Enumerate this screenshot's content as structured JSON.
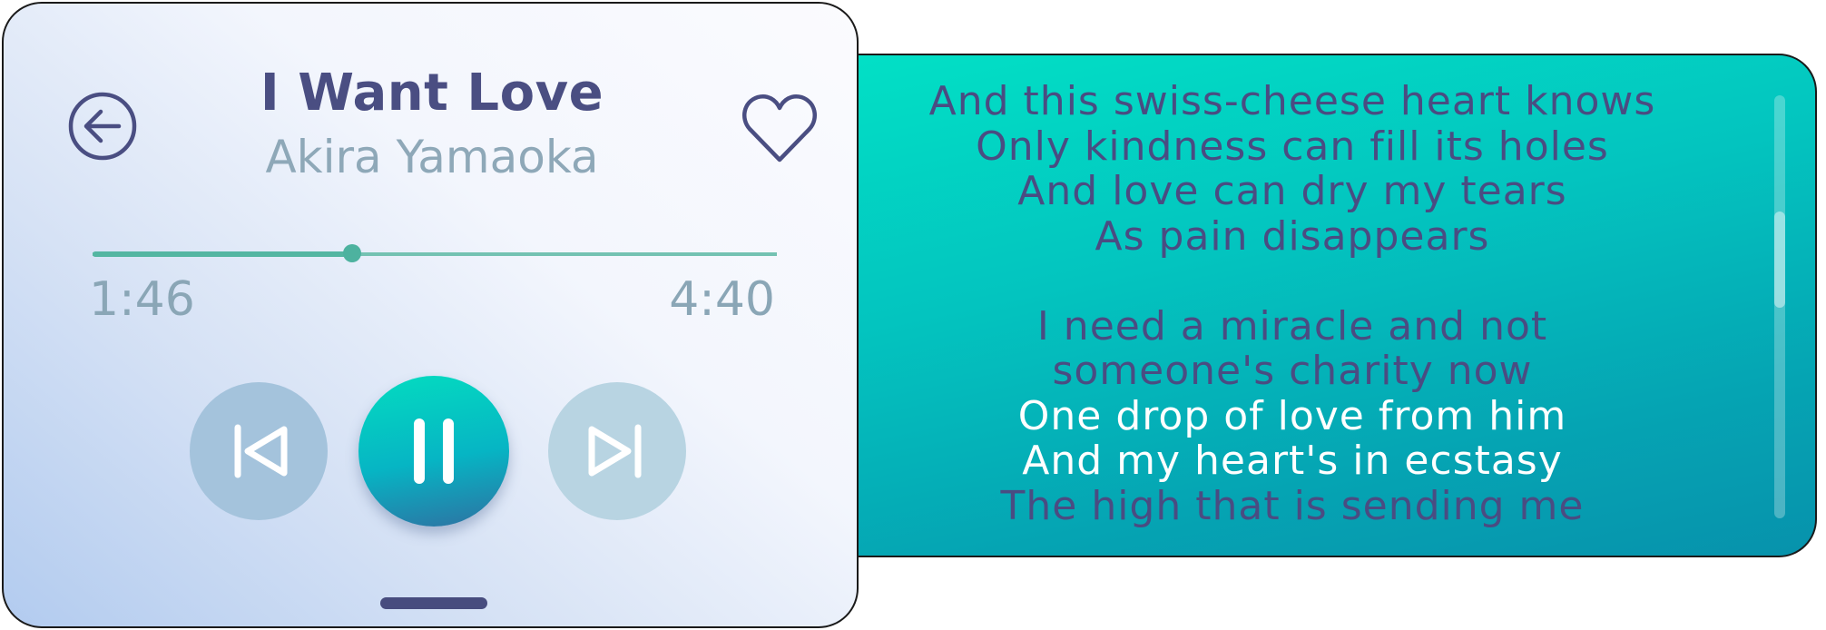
{
  "colors": {
    "accent": "#04dcc0",
    "primary_text": "#4a4e82",
    "secondary_text": "#8ea8b8",
    "progress": "#54b6a2",
    "lyric_active": "#ffffff",
    "lyric_inactive": "#4a4c82"
  },
  "header": {
    "back_icon": "arrow-left-circle-icon",
    "title": "I Want Love",
    "artist": "Akira Yamaoka",
    "favorite_icon": "heart-outline-icon"
  },
  "playback": {
    "elapsed": "1:46",
    "duration": "4:40",
    "progress_fraction": 0.379
  },
  "controls": {
    "previous_icon": "skip-previous-icon",
    "play_pause_icon": "pause-icon",
    "next_icon": "skip-next-icon",
    "state": "playing"
  },
  "lyrics": {
    "stanzas": [
      [
        {
          "text": "And this swiss-cheese heart knows",
          "state": "sung"
        },
        {
          "text": "Only kindness can fill its holes",
          "state": "sung"
        },
        {
          "text": "And love can dry my tears",
          "state": "sung"
        },
        {
          "text": "As pain disappears",
          "state": "sung"
        }
      ],
      [
        {
          "text": "I need a miracle and not",
          "state": "sung"
        },
        {
          "text": "someone's charity now",
          "state": "sung"
        },
        {
          "text": "One drop of love from him",
          "state": "active"
        },
        {
          "text": "And my heart's in ecstasy",
          "state": "active"
        },
        {
          "text": "The high that is sending me",
          "state": "upcoming"
        }
      ]
    ],
    "scroll_position": 0.27
  }
}
